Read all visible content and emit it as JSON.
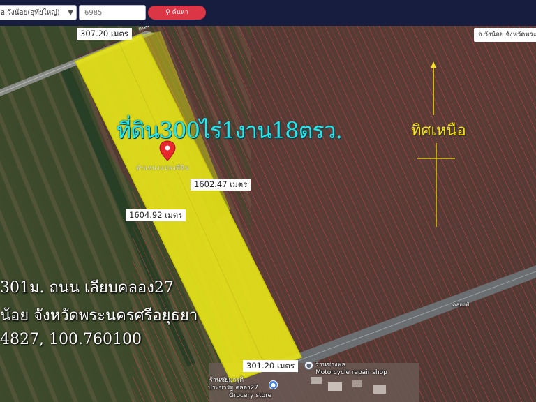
{
  "search": {
    "district_value": "อ.วังน้อย(อุทัยใหญ่)",
    "parcel_value": "6985",
    "button_label": "ค้นหา"
  },
  "map": {
    "province_tag": "อ.วังน้อย จังหวัดพระนครศรีอยุธยา",
    "title_overlay": "ที่ดิน300ไร่1งาน18ตรว.",
    "north_label": "ทิศเหนือ",
    "measurements": {
      "top_edge": "307.20 เมตร",
      "right_edge": "1602.47 เมตร",
      "left_edge": "1604.92 เมตร",
      "bottom_edge": "301.20 เมตร"
    },
    "pin_caption": "ตำแหน่งแปลงที่ดิน",
    "info_lines": [
      "301ม. ถนน เลียบคลอง27",
      "น้อย จังหวัดพระนครศรีอยุธยา",
      "4827, 100.760100"
    ],
    "road_label": "ถนน",
    "pois": {
      "shop_1": "ร้านช่างพล",
      "shop_1_sub": "Motorcycle repair shop",
      "shop_2": "ร้านชัยมารุติ",
      "shop_2_sub": "ประชารัฐ คลอง27",
      "shop_2_tag": "Grocery store",
      "small_tag": "คลองพั"
    },
    "colors": {
      "parcel_fill": "#e6e41a",
      "parcel_border": "#c9c800",
      "plot_lines": "#e43e4f",
      "title_cyan": "#28e6ea",
      "north_yellow": "#f4e21c",
      "pin_red": "#e8282d"
    }
  }
}
